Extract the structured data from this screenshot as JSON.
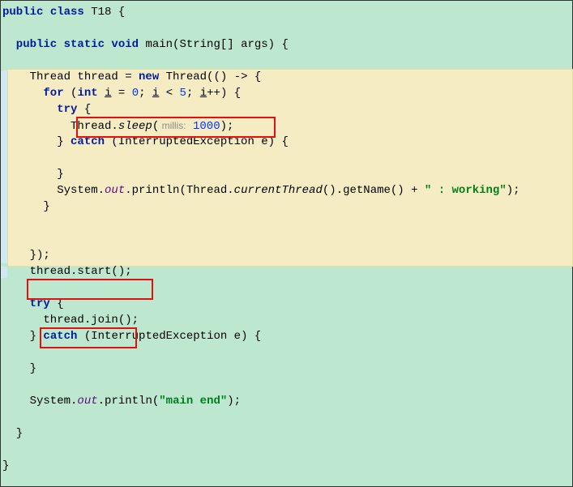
{
  "lines": {
    "l1a": "public",
    "l1b": " class",
    "l1c": " T18 {",
    "l2a": "  public",
    "l2b": " static",
    "l2c": " void",
    "l2d": " main(String[] args) {",
    "l3a": "    Thread thread = ",
    "l3b": "new",
    "l3c": " Thread(() -> {",
    "l4a": "      for",
    "l4b": " (",
    "l4c": "int",
    "l4d": " ",
    "l4e": "i",
    "l4f": " = ",
    "l4g": "0",
    "l4h": "; ",
    "l4i": "i",
    "l4j": " < ",
    "l4k": "5",
    "l4l": "; ",
    "l4m": "i",
    "l4n": "++) {",
    "l5a": "        try",
    "l5b": " {",
    "l6a": "          Thread.",
    "l6b": "sleep",
    "l6c": "(",
    "l6d": " millis:",
    "l6e": " ",
    "l6f": "1000",
    "l6g": ");",
    "l7a": "        } ",
    "l7b": "catch",
    "l7c": " (InterruptedException e) {",
    "l8": "        }",
    "l9a": "        System.",
    "l9b": "out",
    "l9c": ".println(Thread.",
    "l9d": "currentThread",
    "l9e": "().getName() + ",
    "l9f": "\" : working\"",
    "l9g": ");",
    "l10": "      }",
    "l11": "    });",
    "l12": "    thread.start();",
    "l13a": "    try",
    "l13b": " {",
    "l14": "      thread.join();",
    "l15a": "    } ",
    "l15b": "catch",
    "l15c": " (InterruptedException e) {",
    "l16": "    }",
    "l17a": "    System.",
    "l17b": "out",
    "l17c": ".println(",
    "l17d": "\"main end\"",
    "l17e": ");",
    "l18": "  }",
    "l19": "}"
  },
  "boxes": {
    "sleep": "highlight Thread.sleep call",
    "start": "highlight thread.start() call",
    "join": "highlight thread.join() call"
  }
}
